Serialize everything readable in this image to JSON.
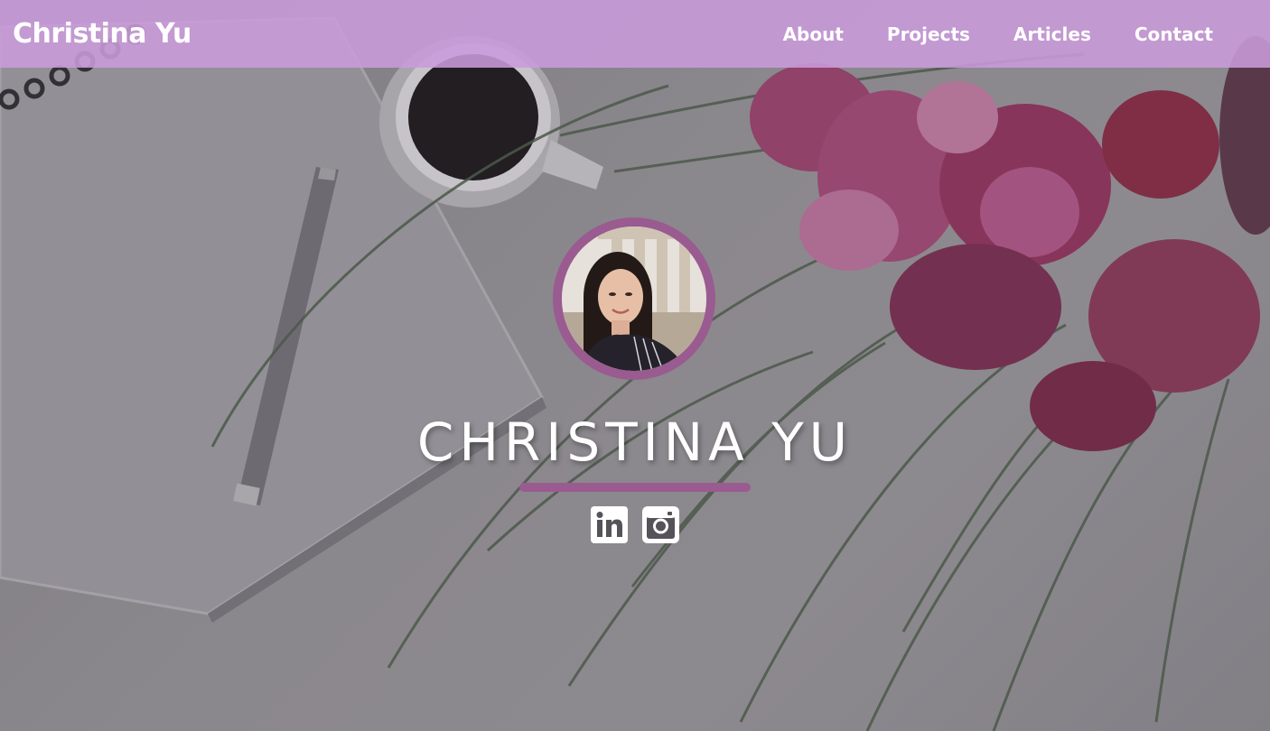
{
  "nav": {
    "brand": "Christina Yu",
    "links": [
      {
        "label": "About"
      },
      {
        "label": "Projects"
      },
      {
        "label": "Articles"
      },
      {
        "label": "Contact"
      }
    ]
  },
  "hero": {
    "name": "CHRISTINA YU",
    "socials": [
      {
        "icon": "linkedin-icon"
      },
      {
        "icon": "instagram-icon"
      }
    ]
  },
  "colors": {
    "navbar": "#c99bdb",
    "accent": "#9a5b91",
    "text": "#ffffff"
  }
}
